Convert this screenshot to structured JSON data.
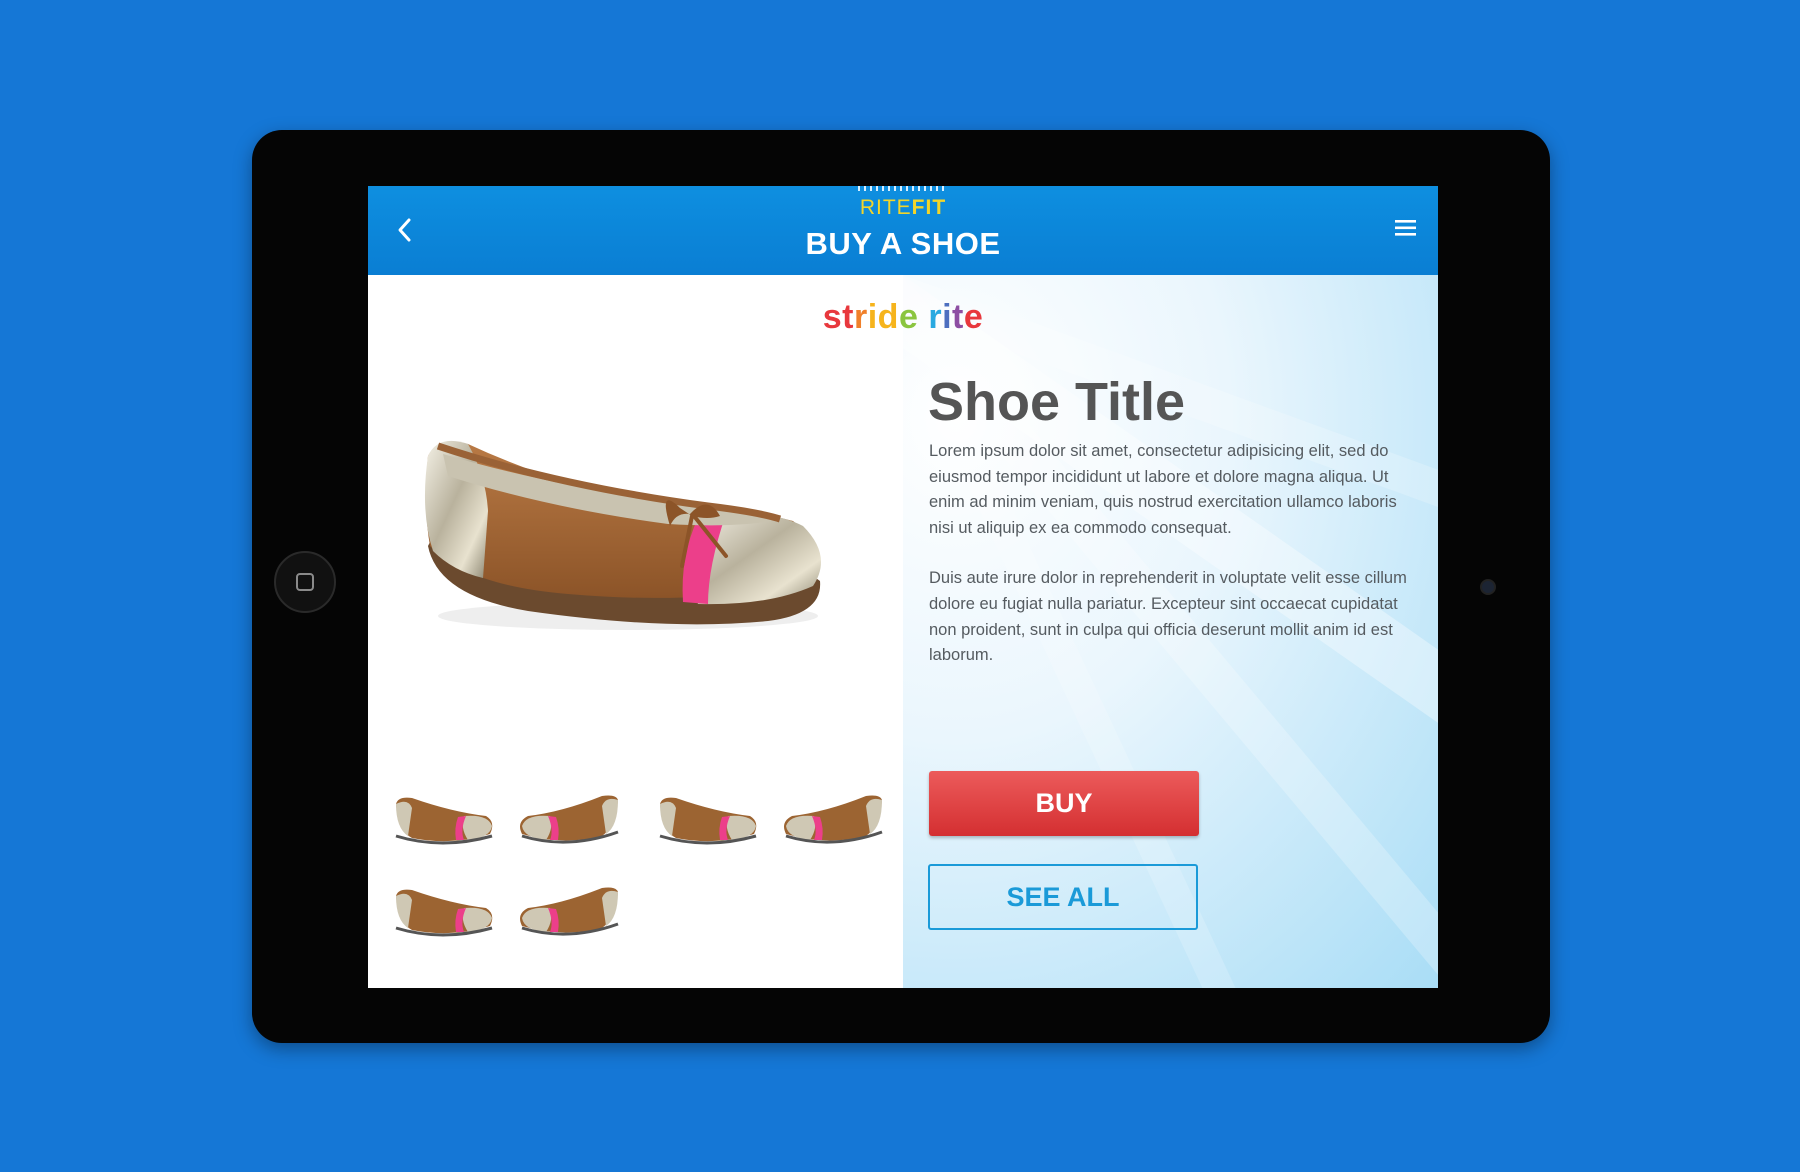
{
  "header": {
    "logo_rite": "RITE",
    "logo_fit": "FIT",
    "title": "BUY A SHOE"
  },
  "brand": {
    "letters": [
      "s",
      "t",
      "r",
      "i",
      "d",
      "e",
      " ",
      "r",
      "i",
      "t",
      "e"
    ],
    "letter_colors": [
      "#e8383d",
      "#e8383d",
      "#f0802a",
      "#f6b41c",
      "#f6b41c",
      "#8bc53f",
      " ",
      "#29a9e0",
      "#4d6fbf",
      "#8e4fa3",
      "#e8383d"
    ]
  },
  "product": {
    "title": "Shoe Title",
    "paragraph_1": "Lorem ipsum dolor sit amet, consectetur adipisicing elit, sed do eiusmod tempor incididunt ut labore et dolore magna aliqua. Ut enim ad minim veniam, quis nostrud exercitation ullamco laboris nisi ut aliquip ex ea commodo consequat.",
    "paragraph_2": "Duis aute irure dolor in reprehenderit in voluptate velit esse cillum dolore eu fugiat nulla pariatur. Excepteur sint occaecat cupidatat non proident, sunt in culpa qui officia deserunt mollit anim id est laborum."
  },
  "actions": {
    "buy_label": "BUY",
    "see_all_label": "SEE ALL"
  },
  "icons": {
    "back": "chevron-left-icon",
    "menu": "hamburger-menu-icon"
  },
  "colors": {
    "background": "#1577d6",
    "header": "#0a86d9",
    "buy": "#d93a3b",
    "see_all": "#1a9ad8",
    "title": "#555555",
    "logo": "#f2d52a"
  }
}
